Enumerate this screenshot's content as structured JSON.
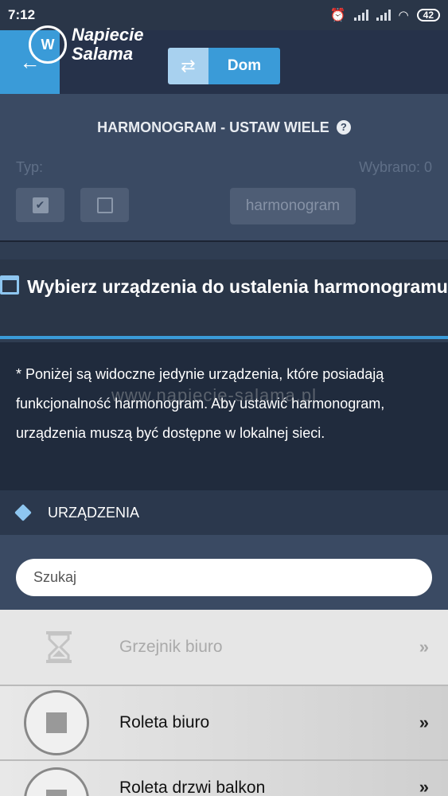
{
  "statusbar": {
    "time": "7:12",
    "battery": "42"
  },
  "header": {
    "logo_line1": "Napiecie",
    "logo_line2": "Salama",
    "logo_mark": "W",
    "home_label": "Dom"
  },
  "bulk": {
    "title": "HARMONOGRAM - USTAW WIELE",
    "type_label": "Typ:",
    "selected_label": "Wybrano: 0",
    "schedule_button": "harmonogram"
  },
  "devices_section": {
    "heading": "Wybierz urządzenia do ustalenia harmonogramu",
    "note": "* Poniżej są widoczne jedynie urządzenia, które posiadają funkcjonalność harmonogram. Aby ustawić harmonogram, urządzenia muszą być dostępne w lokalnej sieci.",
    "watermark": "www.napiecie-salama.pl",
    "list_title": "URZĄDZENIA",
    "search_placeholder": "Szukaj"
  },
  "devices": [
    {
      "name": "Grzejnik biuro",
      "chevron": "»"
    },
    {
      "name": "Roleta biuro",
      "chevron": "»"
    },
    {
      "name": "Roleta drzwi balkon",
      "chevron": "»"
    }
  ],
  "colors": {
    "accent": "#3a9bd8",
    "panel": "#3a4a63",
    "dark": "#202b3d"
  }
}
